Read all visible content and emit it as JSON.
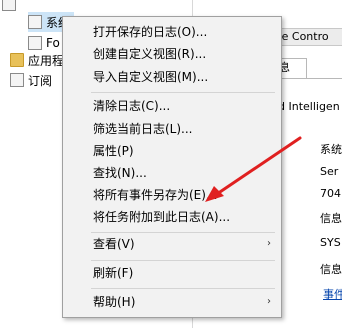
{
  "tree": {
    "items": [
      {
        "label": "",
        "type": "log"
      },
      {
        "label": "系统",
        "type": "log",
        "selected": true
      },
      {
        "label": "Fo",
        "type": "log"
      },
      {
        "label": "应用程",
        "type": "folder"
      },
      {
        "label": "订阅",
        "type": "log"
      }
    ]
  },
  "right_panel": {
    "header": "rice Contro",
    "tab": "信息",
    "intel_text": "d Intelligen",
    "details": [
      "系统",
      "Ser",
      "704",
      "信息",
      "SYS",
      "信息",
      "事件"
    ]
  },
  "context_menu": {
    "items": [
      {
        "label": "打开保存的日志(O)..."
      },
      {
        "label": "创建自定义视图(R)..."
      },
      {
        "label": "导入自定义视图(M)..."
      },
      {
        "label": "清除日志(C)..."
      },
      {
        "label": "筛选当前日志(L)..."
      },
      {
        "label": "属性(P)"
      },
      {
        "label": "查找(N)..."
      },
      {
        "label": "将所有事件另存为(E)..."
      },
      {
        "label": "将任务附加到此日志(A)..."
      },
      {
        "label": "查看(V)",
        "submenu": true
      },
      {
        "label": "刷新(F)"
      },
      {
        "label": "帮助(H)",
        "submenu": true
      }
    ],
    "submenu_arrow": "›"
  },
  "colors": {
    "annotation_arrow": "#e02020",
    "menu_background": "#f2f2f2",
    "selection": "#cce4f7",
    "link": "#0645ad"
  }
}
